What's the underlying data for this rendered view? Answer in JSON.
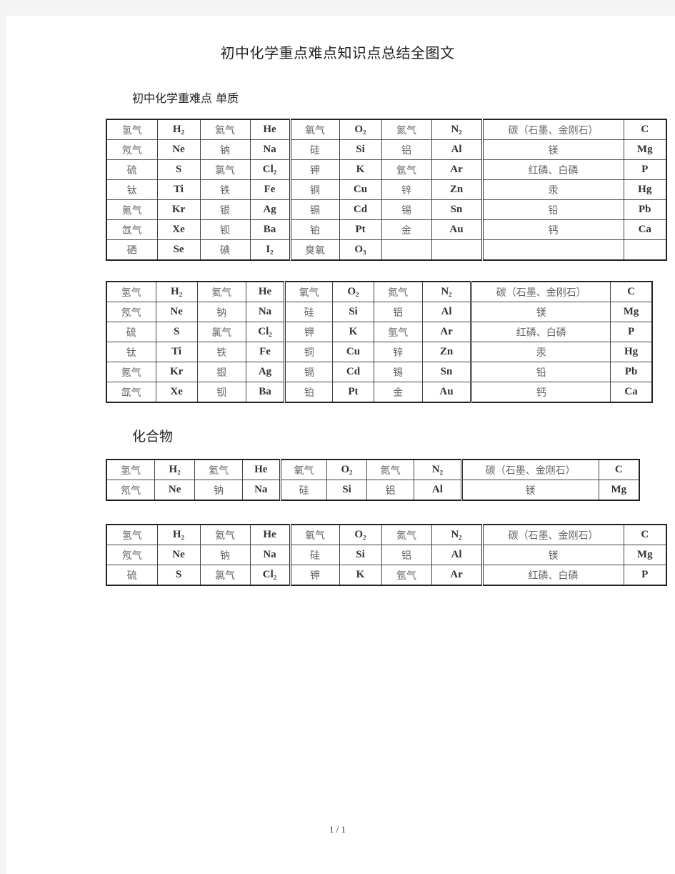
{
  "document": {
    "title": "初中化学重点难点知识点总结全图文",
    "section1_heading": "初中化学重难点 单质",
    "section2_heading": "化合物",
    "page_indicator": "1 / 1"
  },
  "tables": [
    {
      "rows": [
        [
          "氢气",
          "H₂",
          "氦气",
          "He",
          "氧气",
          "O₂",
          "氮气",
          "N₂",
          "碳（石墨、金刚石）",
          "C"
        ],
        [
          "氖气",
          "Ne",
          "钠",
          "Na",
          "硅",
          "Si",
          "铝",
          "Al",
          "镁",
          "Mg"
        ],
        [
          "硫",
          "S",
          "氯气",
          "Cl₂",
          "钾",
          "K",
          "氩气",
          "Ar",
          "红磷、白磷",
          "P"
        ],
        [
          "钛",
          "Ti",
          "铁",
          "Fe",
          "铜",
          "Cu",
          "锌",
          "Zn",
          "汞",
          "Hg"
        ],
        [
          "氪气",
          "Kr",
          "银",
          "Ag",
          "镉",
          "Cd",
          "锡",
          "Sn",
          "铅",
          "Pb"
        ],
        [
          "氙气",
          "Xe",
          "钡",
          "Ba",
          "铂",
          "Pt",
          "金",
          "Au",
          "钙",
          "Ca"
        ],
        [
          "硒",
          "Se",
          "碘",
          "I₂",
          "臭氧",
          "O₃",
          "",
          "",
          "",
          ""
        ]
      ]
    },
    {
      "rows": [
        [
          "氢气",
          "H₂",
          "氦气",
          "He",
          "氧气",
          "O₂",
          "氮气",
          "N₂",
          "碳（石墨、金刚石）",
          "C"
        ],
        [
          "氖气",
          "Ne",
          "钠",
          "Na",
          "硅",
          "Si",
          "铝",
          "Al",
          "镁",
          "Mg"
        ],
        [
          "硫",
          "S",
          "氯气",
          "Cl₂",
          "钾",
          "K",
          "氩气",
          "Ar",
          "红磷、白磷",
          "P"
        ],
        [
          "钛",
          "Ti",
          "铁",
          "Fe",
          "铜",
          "Cu",
          "锌",
          "Zn",
          "汞",
          "Hg"
        ],
        [
          "氪气",
          "Kr",
          "银",
          "Ag",
          "镉",
          "Cd",
          "锡",
          "Sn",
          "铅",
          "Pb"
        ],
        [
          "氙气",
          "Xe",
          "钡",
          "Ba",
          "铂",
          "Pt",
          "金",
          "Au",
          "钙",
          "Ca"
        ]
      ]
    },
    {
      "rows": [
        [
          "氢气",
          "H₂",
          "氦气",
          "He",
          "氧气",
          "O₂",
          "氮气",
          "N₂",
          "碳（石墨、金刚石）",
          "C"
        ],
        [
          "氖气",
          "Ne",
          "钠",
          "Na",
          "硅",
          "Si",
          "铝",
          "Al",
          "镁",
          "Mg"
        ]
      ]
    },
    {
      "rows": [
        [
          "氢气",
          "H₂",
          "氦气",
          "He",
          "氧气",
          "O₂",
          "氮气",
          "N₂",
          "碳（石墨、金刚石）",
          "C"
        ],
        [
          "氖气",
          "Ne",
          "钠",
          "Na",
          "硅",
          "Si",
          "铝",
          "Al",
          "镁",
          "Mg"
        ],
        [
          "硫",
          "S",
          "氯气",
          "Cl₂",
          "钾",
          "K",
          "氩气",
          "Ar",
          "红磷、白磷",
          "P"
        ]
      ]
    }
  ]
}
